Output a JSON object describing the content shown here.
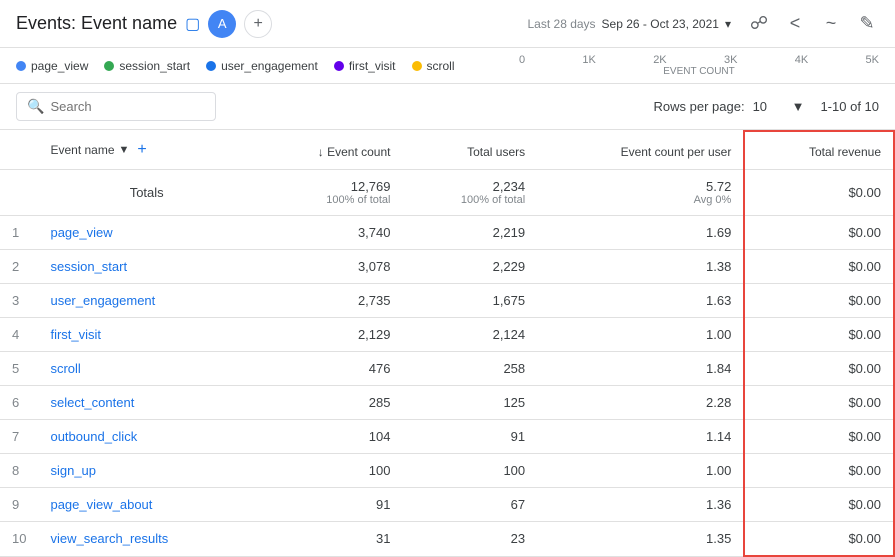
{
  "header": {
    "title": "Events: Event name",
    "avatar": "A",
    "date_range_label": "Last 28 days",
    "date_range": "Sep 26 - Oct 23, 2021",
    "date_range_arrow": "▾"
  },
  "legend": {
    "items": [
      {
        "label": "page_view",
        "color": "#4285f4"
      },
      {
        "label": "session_start",
        "color": "#34a853"
      },
      {
        "label": "user_engagement",
        "color": "#1a73e8"
      },
      {
        "label": "first_visit",
        "color": "#6200ea"
      },
      {
        "label": "scroll",
        "color": "#fbbc04"
      }
    ]
  },
  "chart": {
    "x_labels": [
      "0",
      "1K",
      "2K",
      "3K",
      "4K",
      "5K"
    ],
    "x_axis_label": "EVENT COUNT"
  },
  "toolbar": {
    "search_placeholder": "Search",
    "rows_per_page_label": "Rows per page:",
    "rows_per_page_value": "10",
    "pagination": "1-10 of 10"
  },
  "table": {
    "columns": [
      {
        "id": "row_num",
        "label": ""
      },
      {
        "id": "event_name",
        "label": "Event name",
        "sortable": true,
        "add": true
      },
      {
        "id": "event_count",
        "label": "↓ Event count",
        "numeric": true
      },
      {
        "id": "total_users",
        "label": "Total users",
        "numeric": true
      },
      {
        "id": "event_count_per_user",
        "label": "Event count per user",
        "numeric": true
      },
      {
        "id": "total_revenue",
        "label": "Total revenue",
        "numeric": true,
        "highlighted": true
      }
    ],
    "totals": {
      "label": "Totals",
      "event_count": "12,769",
      "event_count_sub": "100% of total",
      "total_users": "2,234",
      "total_users_sub": "100% of total",
      "event_count_per_user": "5.72",
      "event_count_per_user_sub": "Avg 0%",
      "total_revenue": "$0.00"
    },
    "rows": [
      {
        "num": 1,
        "event_name": "page_view",
        "event_count": "3,740",
        "total_users": "2,219",
        "event_count_per_user": "1.69",
        "total_revenue": "$0.00"
      },
      {
        "num": 2,
        "event_name": "session_start",
        "event_count": "3,078",
        "total_users": "2,229",
        "event_count_per_user": "1.38",
        "total_revenue": "$0.00"
      },
      {
        "num": 3,
        "event_name": "user_engagement",
        "event_count": "2,735",
        "total_users": "1,675",
        "event_count_per_user": "1.63",
        "total_revenue": "$0.00"
      },
      {
        "num": 4,
        "event_name": "first_visit",
        "event_count": "2,129",
        "total_users": "2,124",
        "event_count_per_user": "1.00",
        "total_revenue": "$0.00"
      },
      {
        "num": 5,
        "event_name": "scroll",
        "event_count": "476",
        "total_users": "258",
        "event_count_per_user": "1.84",
        "total_revenue": "$0.00"
      },
      {
        "num": 6,
        "event_name": "select_content",
        "event_count": "285",
        "total_users": "125",
        "event_count_per_user": "2.28",
        "total_revenue": "$0.00"
      },
      {
        "num": 7,
        "event_name": "outbound_click",
        "event_count": "104",
        "total_users": "91",
        "event_count_per_user": "1.14",
        "total_revenue": "$0.00"
      },
      {
        "num": 8,
        "event_name": "sign_up",
        "event_count": "100",
        "total_users": "100",
        "event_count_per_user": "1.00",
        "total_revenue": "$0.00"
      },
      {
        "num": 9,
        "event_name": "page_view_about",
        "event_count": "91",
        "total_users": "67",
        "event_count_per_user": "1.36",
        "total_revenue": "$0.00"
      },
      {
        "num": 10,
        "event_name": "view_search_results",
        "event_count": "31",
        "total_users": "23",
        "event_count_per_user": "1.35",
        "total_revenue": "$0.00"
      }
    ]
  }
}
